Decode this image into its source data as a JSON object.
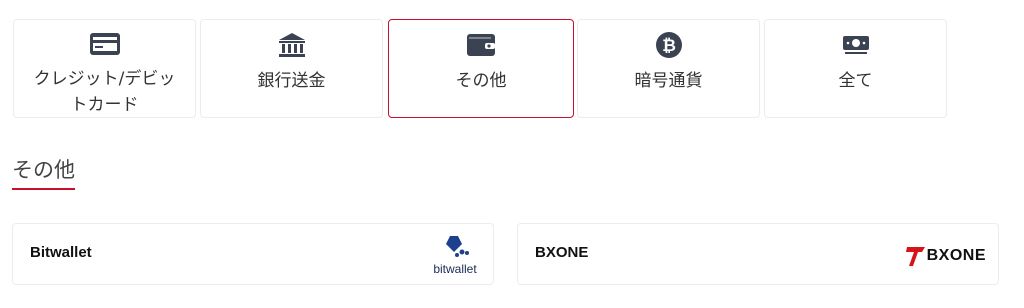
{
  "tabs": [
    {
      "label": "クレジット/デビットカード",
      "icon": "credit-card-icon",
      "active": false
    },
    {
      "label": "銀行送金",
      "icon": "bank-icon",
      "active": false
    },
    {
      "label": "その他",
      "icon": "wallet-icon",
      "active": true
    },
    {
      "label": "暗号通貨",
      "icon": "bitcoin-icon",
      "active": false
    },
    {
      "label": "全て",
      "icon": "cash-icon",
      "active": false
    }
  ],
  "section": {
    "title": "その他"
  },
  "methods": [
    {
      "name": "Bitwallet",
      "logo_text": "bitwallet"
    },
    {
      "name": "BXONE",
      "logo_text": "BXONE"
    }
  ],
  "colors": {
    "accent": "#c8102e",
    "icon": "#3b4251",
    "border": "#ececec"
  }
}
